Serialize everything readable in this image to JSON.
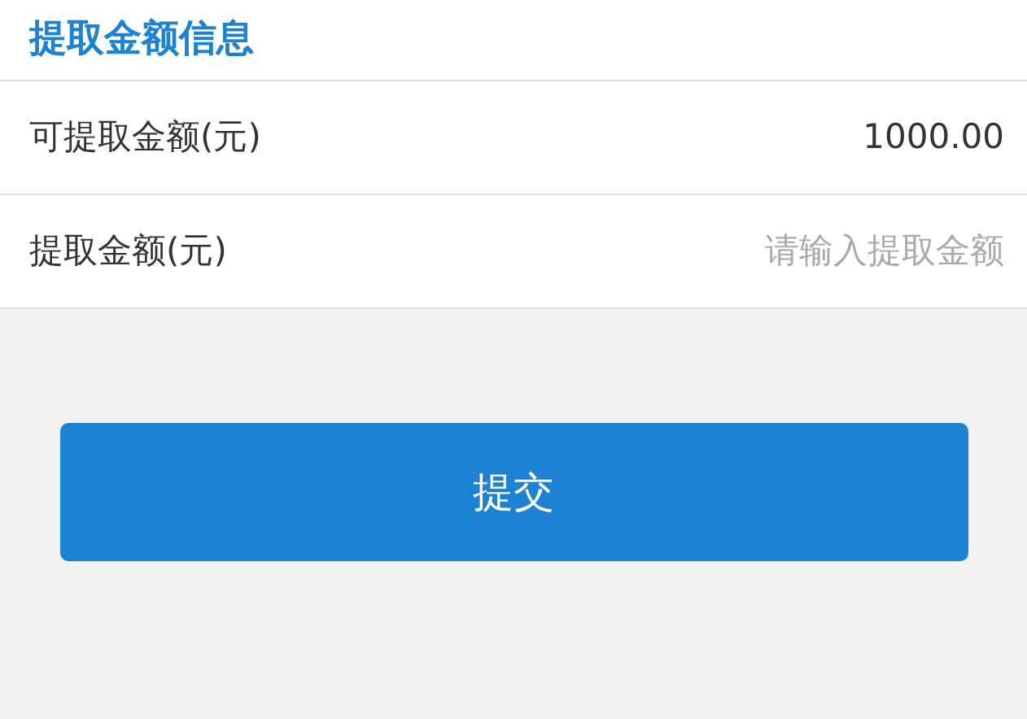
{
  "section_title": "提取金额信息",
  "rows": [
    {
      "kind": "value",
      "label": "可提取金额(元)",
      "value": "1000.00"
    },
    {
      "kind": "input",
      "label": "提取金额(元)",
      "placeholder": "请输入提取金额"
    }
  ],
  "submit_button": "提交"
}
